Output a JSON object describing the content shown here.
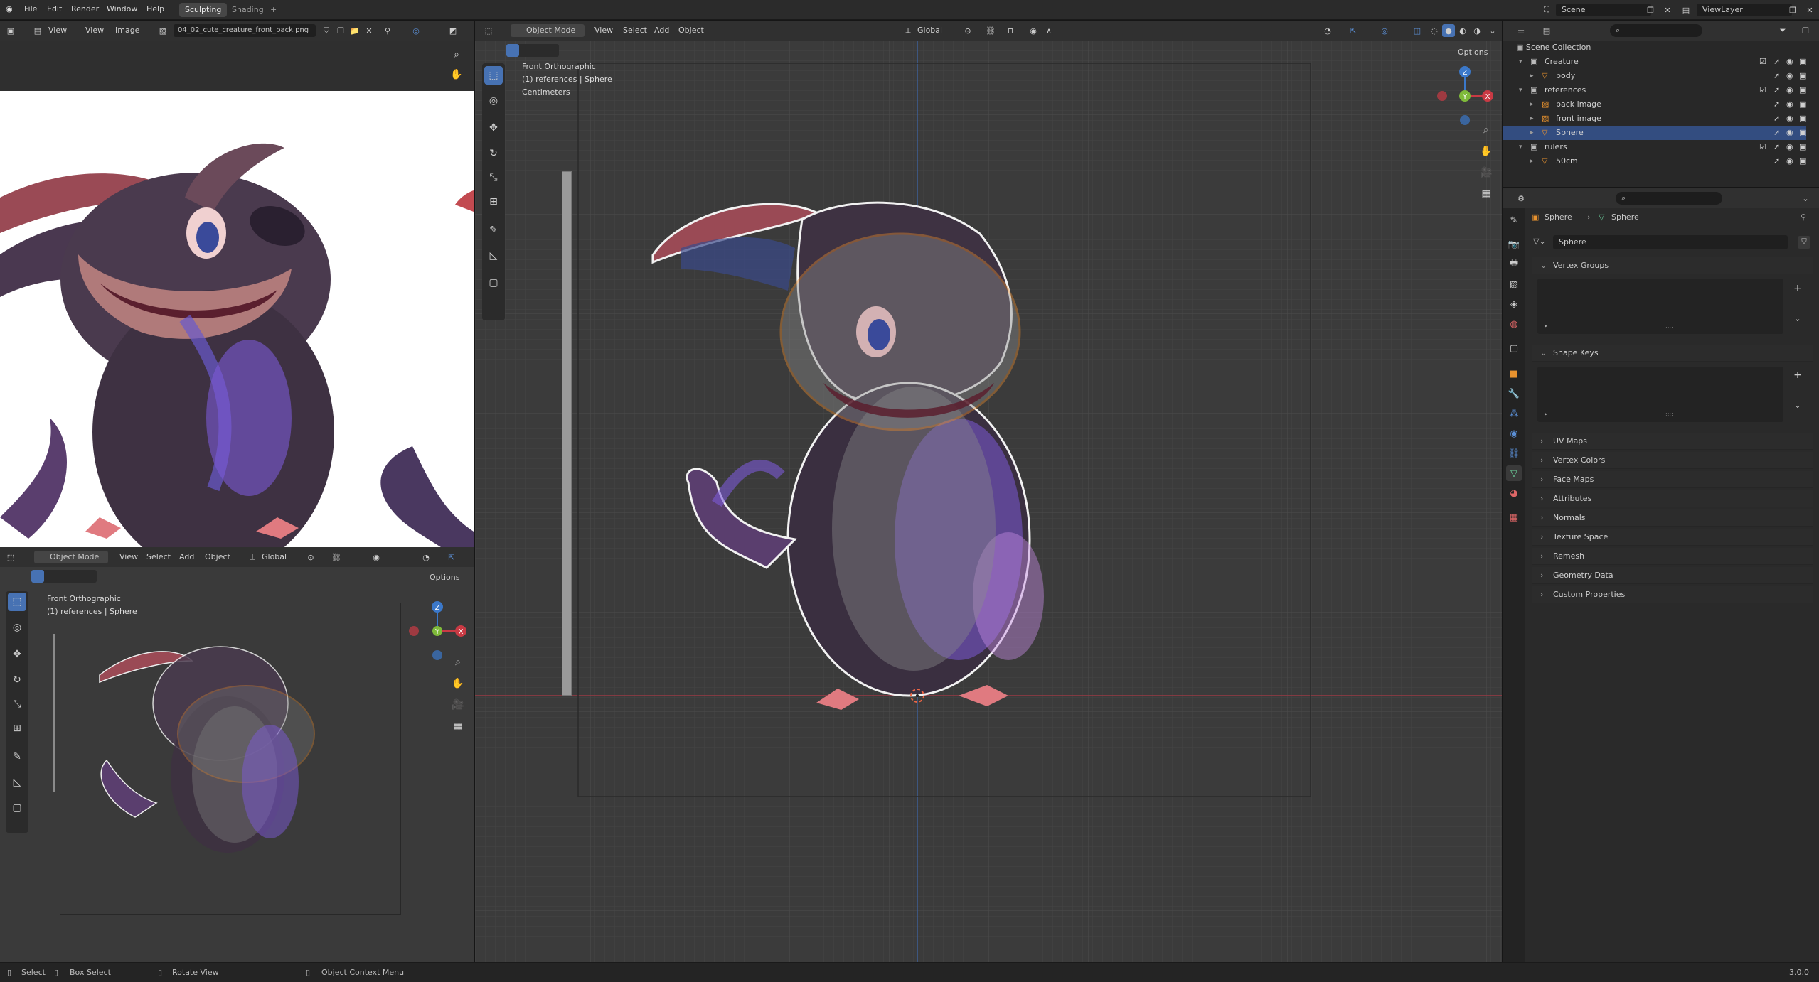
{
  "topbar": {
    "menus": [
      "File",
      "Edit",
      "Render",
      "Window",
      "Help"
    ],
    "workspaces": [
      "Sculpting",
      "Shading"
    ],
    "add_tab": "+",
    "scene_label": "Scene",
    "viewlayer_label": "ViewLayer"
  },
  "image_editor": {
    "menus": [
      "View",
      "View",
      "Image"
    ],
    "image_name": "04_02_cute_creature_front_back.png"
  },
  "viewport_small": {
    "mode": "Object Mode",
    "menus": [
      "View",
      "Select",
      "Add",
      "Object"
    ],
    "orientation": "Global",
    "options": "Options",
    "overlay_line1": "Front Orthographic",
    "overlay_line2": "(1) references | Sphere"
  },
  "viewport_main": {
    "mode": "Object Mode",
    "menus": [
      "View",
      "Select",
      "Add",
      "Object"
    ],
    "orientation": "Global",
    "options": "Options",
    "overlay_line1": "Front Orthographic",
    "overlay_line2": "(1) references | Sphere",
    "overlay_line3": "Centimeters"
  },
  "gizmo": {
    "x": "X",
    "y": "Y",
    "z": "Z"
  },
  "outliner": {
    "root": "Scene Collection",
    "rows": [
      {
        "label": "Creature",
        "indent": 0
      },
      {
        "label": "body",
        "indent": 1
      },
      {
        "label": "references",
        "indent": 0
      },
      {
        "label": "back image",
        "indent": 1
      },
      {
        "label": "front image",
        "indent": 1
      },
      {
        "label": "Sphere",
        "indent": 1,
        "selected": true
      },
      {
        "label": "rulers",
        "indent": 0
      },
      {
        "label": "50cm",
        "indent": 1
      }
    ]
  },
  "properties": {
    "breadcrumb_1": "Sphere",
    "breadcrumb_2": "Sphere",
    "mesh_name": "Sphere",
    "panels": [
      "Vertex Groups",
      "Shape Keys",
      "UV Maps",
      "Vertex Colors",
      "Face Maps",
      "Attributes",
      "Normals",
      "Texture Space",
      "Remesh",
      "Geometry Data",
      "Custom Properties"
    ]
  },
  "statusbar": {
    "select": "Select",
    "box_select": "Box Select",
    "rotate_view": "Rotate View",
    "context_menu": "Object Context Menu",
    "version": "3.0.0"
  },
  "colors": {
    "accent": "#4772b3",
    "selection_orange": "#e68a2e",
    "axis_red": "#c93a44",
    "axis_green": "#7fba3a",
    "axis_blue": "#3b78c9"
  }
}
